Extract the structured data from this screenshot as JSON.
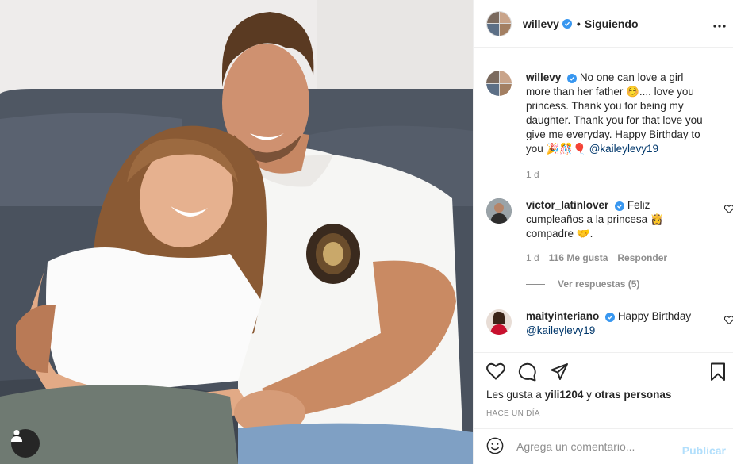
{
  "post": {
    "image_alt": "Photo of a father and daughter smiling on a sofa",
    "author": {
      "username": "willevy",
      "verified": true
    },
    "follow_status": "Siguiendo",
    "caption": {
      "username": "willevy",
      "text": "No one can love a girl more than her father ☺️.... love you princess. Thank you for being my daughter. Thank you for that love you give me everyday. Happy Birthday to you 🎉🎊🎈",
      "mention": "@kaileylevy19",
      "time": "1 d"
    },
    "comments": [
      {
        "username": "victor_latinlover",
        "verified": true,
        "text": "Feliz cumpleaños a la princesa 👸 compadre 🤝.",
        "time": "1 d",
        "likes": "116 Me gusta",
        "reply_label": "Responder",
        "view_replies": "Ver respuestas (5)"
      },
      {
        "username": "maityinteriano",
        "verified": true,
        "text": "Happy Birthday",
        "mention": "@kaileylevy19"
      }
    ],
    "likes_prefix": "Les gusta a",
    "likes_user": "yili1204",
    "likes_connector": "y",
    "likes_others": "otras personas",
    "date": "HACE UN DÍA",
    "comment_placeholder": "Agrega un comentario...",
    "publish_label": "Publicar"
  },
  "icons": {
    "more": "more-options-icon",
    "like": "heart-icon",
    "comment": "comment-bubble-icon",
    "share": "share-paper-plane-icon",
    "save": "bookmark-icon",
    "emoji": "emoji-icon",
    "tag": "user-tag-icon"
  },
  "colors": {
    "verified": "#3897f0",
    "publish_disabled": "#b2dffc",
    "muted": "#8e8e8e",
    "mention": "#00376b"
  }
}
